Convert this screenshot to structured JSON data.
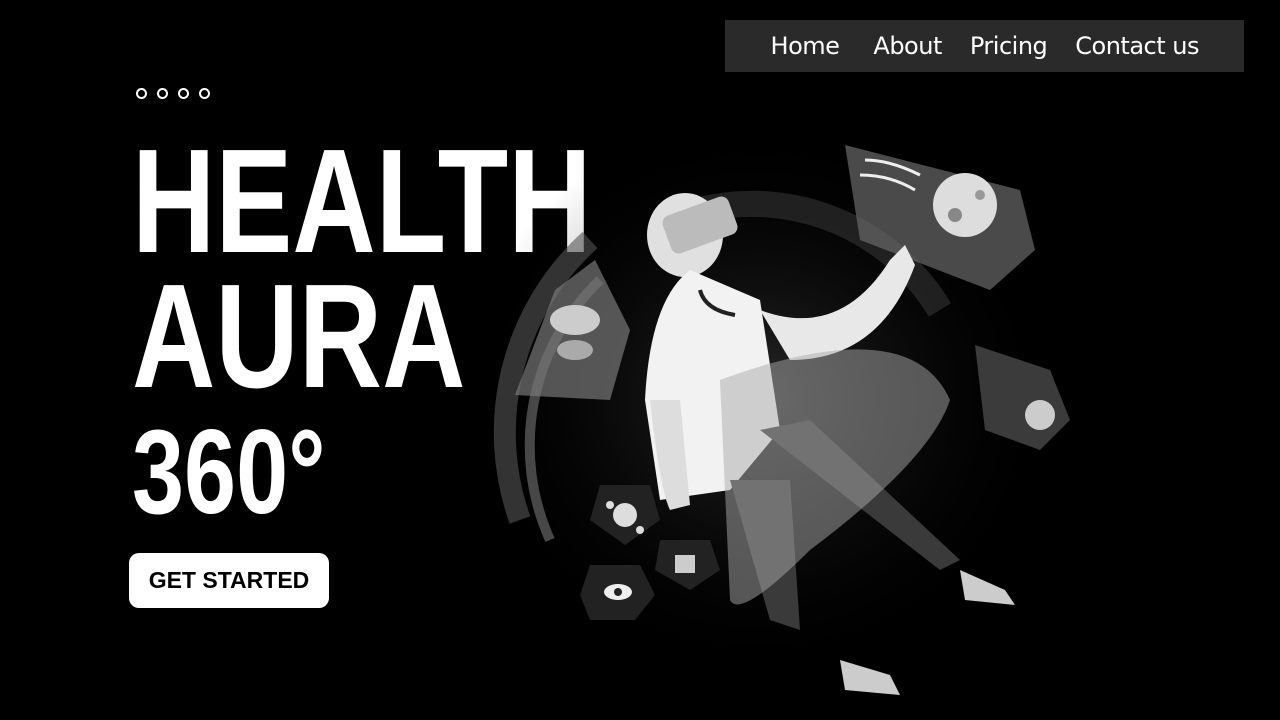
{
  "nav": {
    "items": [
      "Home",
      "About",
      "Pricing",
      "Contact us"
    ]
  },
  "hero": {
    "line1": "HEALTH",
    "line2": "AURA",
    "line3": "360°",
    "cta_label": "GET STARTED"
  },
  "illustration": {
    "subject": "doctor-vr-illustration",
    "icons": [
      "brain-icon",
      "stomach-icon",
      "virus-icon",
      "eye-scan-icon",
      "puzzle-icon",
      "lungs-icon"
    ]
  },
  "colors": {
    "background": "#000000",
    "nav_bg": "#2a2a2a",
    "text": "#ffffff"
  }
}
